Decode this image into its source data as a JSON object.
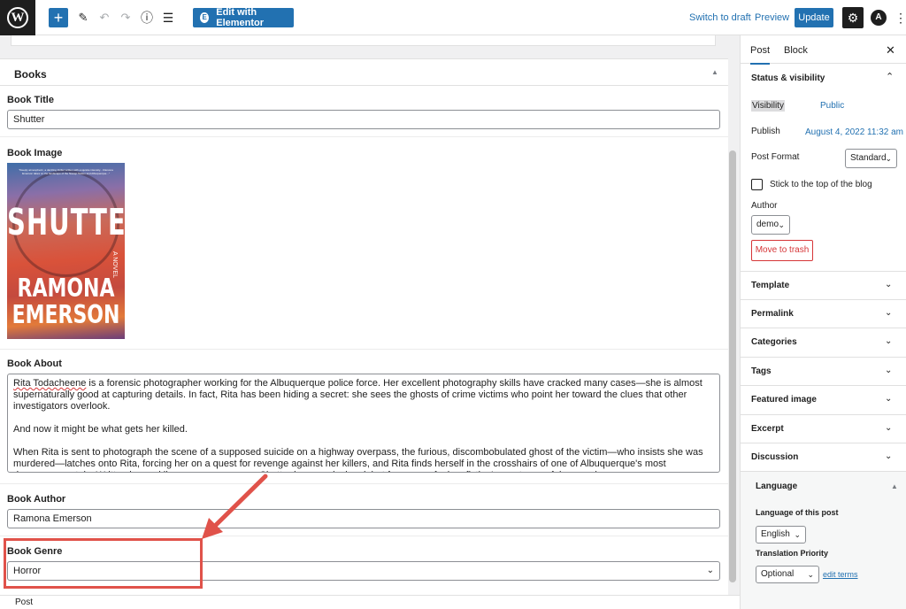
{
  "toolbar": {
    "logo": "W",
    "add_icon": "+",
    "edit_icon": "✎",
    "undo_icon": "↶",
    "redo_icon": "↷",
    "info_icon": "ⓘ",
    "list_icon": "☰",
    "elementor_icon": "E",
    "elementor_label": "Edit with Elementor",
    "switch_draft": "Switch to draft",
    "preview": "Preview",
    "update": "Update",
    "settings_icon": "⚙",
    "astra_icon": "A",
    "more_icon": "⋮"
  },
  "metabox": {
    "title": "Books",
    "caret": "▲",
    "fields": {
      "book_title": {
        "label": "Book Title",
        "value": "Shutter"
      },
      "book_image": {
        "label": "Book Image"
      },
      "book_about": {
        "label": "Book About",
        "p1_name": "Rita Todacheene",
        "p1_rest": " is a forensic photographer working for the Albuquerque police force. Her excellent photography skills have cracked many cases—she is almost supernaturally good at capturing details. In fact, Rita has been hiding a secret: she sees the ghosts of crime victims who point her toward the clues that other investigators overlook.",
        "p2": "And now it might be what gets her killed.",
        "p3": "When Rita is sent to photograph the scene of a supposed suicide on a highway overpass, the furious, discombobulated ghost of the victim—who insists she was murdered—latches onto Rita, forcing her on a quest for revenge against her killers, and Rita finds herself in the crosshairs of one of Albuquerque's most dangerous cartels. Written in sparkling, gruesome prose, Shutter is an explosive debut from one of crime fiction's most powerful new voices."
      },
      "book_author": {
        "label": "Book Author",
        "value": "Ramona Emerson"
      },
      "book_genre": {
        "label": "Book Genre",
        "value": "Horror"
      }
    },
    "cover": {
      "blurb": "\"Deeply atmospheric, a dazzling thriller written with exquisite intensity... Ramona Emerson takes on the landscape of the Navajo Nation and Albuquerque...\"",
      "title": "SHUTTER",
      "subtitle": "A NOVEL",
      "author_first": "RAMONA",
      "author_last": "EMERSON"
    }
  },
  "footer": {
    "breadcrumb": "Post"
  },
  "sidebar": {
    "tabs": [
      "Post",
      "Block"
    ],
    "close_icon": "✕",
    "status": {
      "title": "Status & visibility",
      "visibility_label": "Visibility",
      "visibility_value": "Public",
      "publish_label": "Publish",
      "publish_value": "August 4, 2022 11:32 am",
      "format_label": "Post Format",
      "format_value": "Standard",
      "sticky_label": "Stick to the top of the blog",
      "author_label": "Author",
      "author_value": "demo",
      "trash": "Move to trash"
    },
    "panels": [
      "Template",
      "Permalink",
      "Categories",
      "Tags",
      "Featured image",
      "Excerpt",
      "Discussion"
    ],
    "language": {
      "title": "Language",
      "post_lang_label": "Language of this post",
      "post_lang_value": "English",
      "priority_label": "Translation Priority",
      "priority_value": "Optional",
      "edit_terms": "edit terms"
    },
    "chevron_down": "⌄",
    "chevron_up": "⌃"
  },
  "colors": {
    "accent": "#2271b1",
    "annotation": "#e0524a",
    "danger": "#d63638"
  }
}
